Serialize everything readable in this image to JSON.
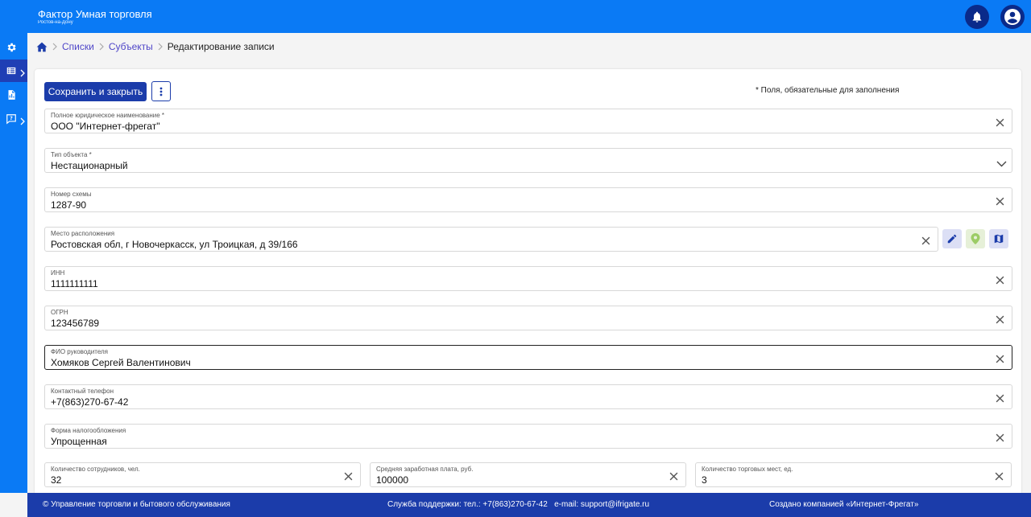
{
  "header": {
    "title": "Фактор Умная торговля",
    "subtitle": "Ростов-на-Дону",
    "bell_icon": "bell-icon",
    "account_icon": "account-icon",
    "bg": "#0a7af5"
  },
  "sidebar": {
    "items": [
      {
        "icon": "gear-icon"
      },
      {
        "icon": "list-icon",
        "active": true
      },
      {
        "icon": "report-icon"
      },
      {
        "icon": "help-icon"
      }
    ]
  },
  "breadcrumb": {
    "home_icon": "home-icon",
    "items": [
      "Списки",
      "Субъекты",
      "Редактирование записи"
    ]
  },
  "toolbar": {
    "save_label": "Сохранить и закрыть",
    "required_note": "* Поля, обязательные для заполнения"
  },
  "fields": {
    "full_name": {
      "label": "Полное юридическое наименование *",
      "value": "ООО \"Интернет-фрегат\""
    },
    "object_type": {
      "label": "Тип объекта *",
      "value": "Нестационарный"
    },
    "scheme_number": {
      "label": "Номер схемы",
      "value": "1287-90"
    },
    "location": {
      "label": "Место расположения",
      "value": "Ростовская обл, г Новочеркасск, ул Троицкая, д 39/166"
    },
    "inn": {
      "label": "ИНН",
      "value": "1111111111"
    },
    "ogrn": {
      "label": "ОГРН",
      "value": "123456789"
    },
    "director": {
      "label": "ФИО руководителя",
      "value": "Хомяков Сергей Валентинович"
    },
    "phone": {
      "label": "Контактный телефон",
      "value": "+7(863)270-67-42"
    },
    "tax_form": {
      "label": "Форма налогообложения",
      "value": "Упрощенная"
    },
    "employees": {
      "label": "Количество сотрудников, чел.",
      "value": "32"
    },
    "salary": {
      "label": "Средняя заработная плата, руб.",
      "value": "100000"
    },
    "trade_places": {
      "label": "Количество торговых мест, ед.",
      "value": "3"
    }
  },
  "footer": {
    "left": "© Управление торговли и бытового обслуживания",
    "support": "Служба поддержки: тел.: +7(863)270-67-42   e-mail: support@ifrigate.ru",
    "created": "Создано компанией «Интернет-Фрегат»"
  },
  "colors": {
    "accent": "#0a7af5",
    "primary_dark": "#1b3caa",
    "link": "#4f46c8"
  }
}
